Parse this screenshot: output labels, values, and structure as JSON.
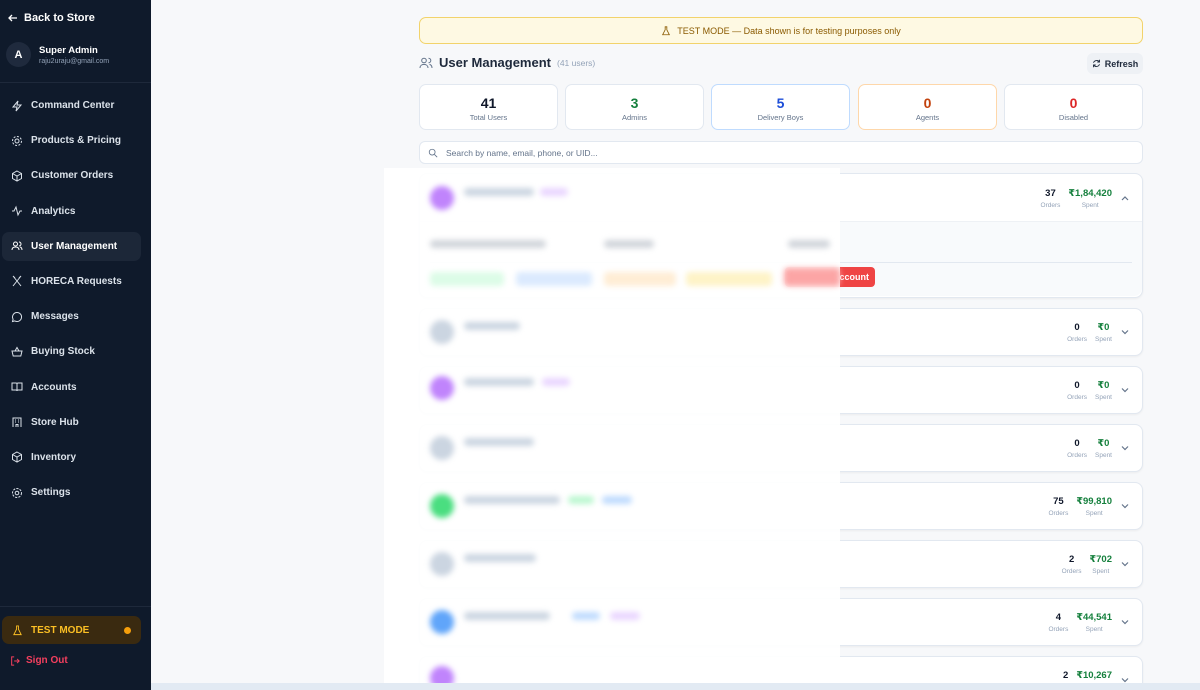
{
  "sidebar": {
    "back_label": "Back to Store",
    "admin": {
      "initial": "A",
      "name": "Super Admin",
      "email": "raju2uraju@gmail.com"
    },
    "items": [
      {
        "label": "Command Center",
        "icon": "lightning-icon"
      },
      {
        "label": "Products & Pricing",
        "icon": "gear-icon"
      },
      {
        "label": "Customer Orders",
        "icon": "package-icon"
      },
      {
        "label": "Analytics",
        "icon": "activity-icon"
      },
      {
        "label": "User Management",
        "icon": "users-icon",
        "active": true
      },
      {
        "label": "HORECA Requests",
        "icon": "utensils-icon"
      },
      {
        "label": "Messages",
        "icon": "message-icon"
      },
      {
        "label": "Buying Stock",
        "icon": "basket-icon"
      },
      {
        "label": "Accounts",
        "icon": "book-icon"
      },
      {
        "label": "Store Hub",
        "icon": "building-icon"
      },
      {
        "label": "Inventory",
        "icon": "box-icon"
      },
      {
        "label": "Settings",
        "icon": "settings-icon"
      }
    ],
    "test_mode_label": "TEST MODE",
    "signout_label": "Sign Out"
  },
  "banner": {
    "text": "TEST MODE — Data shown is for testing purposes only"
  },
  "header": {
    "title": "User Management",
    "count": "(41 users)",
    "refresh_label": "Refresh"
  },
  "stats": [
    {
      "value": "41",
      "label": "Total Users",
      "color": "#0f172a"
    },
    {
      "value": "3",
      "label": "Admins",
      "color": "#15803d"
    },
    {
      "value": "5",
      "label": "Delivery Boys",
      "color": "#1d4ed8"
    },
    {
      "value": "0",
      "label": "Agents",
      "color": "#c2410c"
    },
    {
      "value": "0",
      "label": "Disabled",
      "color": "#dc2626"
    }
  ],
  "search": {
    "placeholder": "Search by name, email, phone, or UID..."
  },
  "users": [
    {
      "orders": "37",
      "spent": "₹1,84,420",
      "expanded": true
    },
    {
      "orders": "0",
      "spent": "₹0"
    },
    {
      "orders": "0",
      "spent": "₹0"
    },
    {
      "orders": "0",
      "spent": "₹0"
    },
    {
      "orders": "75",
      "spent": "₹99,810"
    },
    {
      "orders": "2",
      "spent": "₹702"
    },
    {
      "orders": "4",
      "spent": "₹44,541"
    },
    {
      "orders": "2",
      "spent": "₹10,267"
    }
  ],
  "labels": {
    "orders": "Orders",
    "spent": "Spent",
    "delete_account": "Account"
  }
}
